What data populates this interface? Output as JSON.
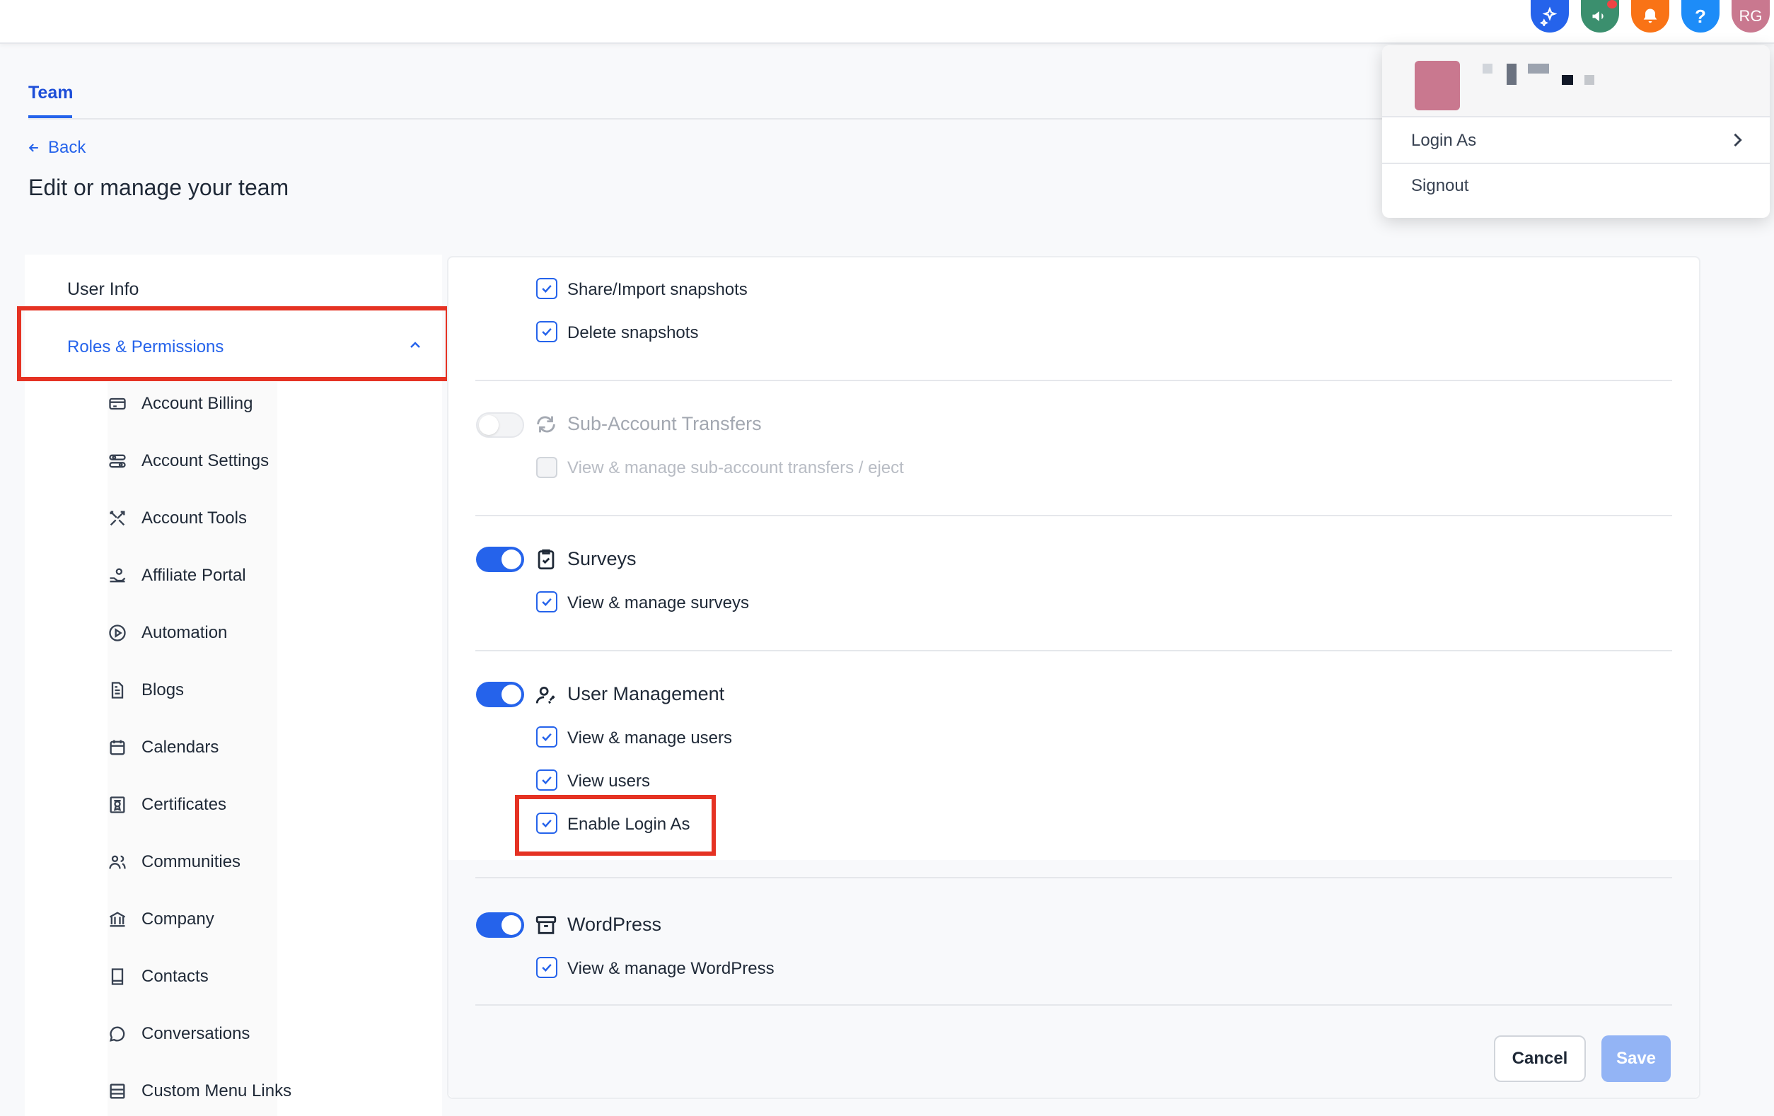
{
  "header": {
    "icons": [
      {
        "name": "sparkle-icon",
        "color": "#2563eb"
      },
      {
        "name": "megaphone-icon",
        "color": "#3b8f6e"
      },
      {
        "name": "bell-icon",
        "color": "#f97316"
      },
      {
        "name": "help-icon",
        "color": "#1d8cf8",
        "glyph": "?"
      },
      {
        "name": "avatar",
        "color": "#c9788f",
        "initials": "RG"
      }
    ]
  },
  "profile_menu": {
    "login_as_label": "Login As",
    "signout_label": "Signout"
  },
  "tabs": {
    "team": "Team"
  },
  "nav": {
    "back_label": "Back"
  },
  "page": {
    "title": "Edit or manage your team"
  },
  "sidebar": {
    "user_info": "User Info",
    "roles_permissions": "Roles & Permissions",
    "items": [
      {
        "label": "Account Billing",
        "icon": "credit-card-icon"
      },
      {
        "label": "Account Settings",
        "icon": "settings-sliders-icon"
      },
      {
        "label": "Account Tools",
        "icon": "tools-icon"
      },
      {
        "label": "Affiliate Portal",
        "icon": "affiliate-icon"
      },
      {
        "label": "Automation",
        "icon": "play-circle-icon"
      },
      {
        "label": "Blogs",
        "icon": "document-icon"
      },
      {
        "label": "Calendars",
        "icon": "calendar-icon"
      },
      {
        "label": "Certificates",
        "icon": "certificate-icon"
      },
      {
        "label": "Communities",
        "icon": "users-icon"
      },
      {
        "label": "Company",
        "icon": "bank-icon"
      },
      {
        "label": "Contacts",
        "icon": "book-icon"
      },
      {
        "label": "Conversations",
        "icon": "chat-bubble-icon"
      },
      {
        "label": "Custom Menu Links",
        "icon": "menu-links-icon"
      }
    ]
  },
  "permissions": {
    "snapshots": {
      "share_import": "Share/Import snapshots",
      "delete": "Delete snapshots"
    },
    "sub_account_transfers": {
      "title": "Sub-Account Transfers",
      "enabled": false,
      "view_manage": "View & manage sub-account transfers / eject"
    },
    "surveys": {
      "title": "Surveys",
      "enabled": true,
      "view_manage": "View & manage surveys"
    },
    "user_management": {
      "title": "User Management",
      "enabled": true,
      "view_manage": "View & manage users",
      "view": "View users",
      "enable_login_as": "Enable Login As"
    },
    "wordpress": {
      "title": "WordPress",
      "enabled": true,
      "view_manage": "View & manage WordPress"
    }
  },
  "actions": {
    "cancel": "Cancel",
    "save": "Save"
  },
  "colors": {
    "accent": "#2563eb",
    "highlight": "#e53223"
  }
}
